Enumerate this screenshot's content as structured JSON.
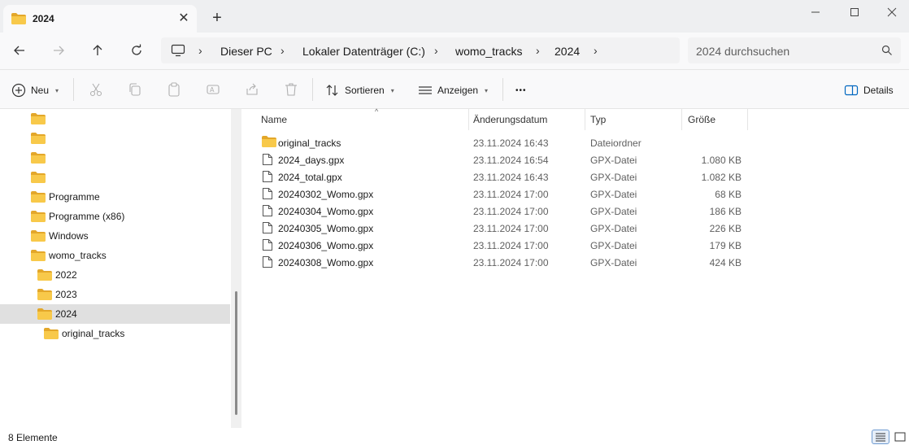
{
  "window": {
    "tab_title": "2024",
    "tab_close": "✕",
    "new_tab": "+"
  },
  "address": {
    "crumbs": [
      "Dieser PC",
      "Lokaler Datenträger (C:)",
      "womo_tracks",
      "2024"
    ],
    "separator": "›",
    "search_placeholder": "2024 durchsuchen"
  },
  "toolbar": {
    "new_label": "Neu",
    "sort_label": "Sortieren",
    "view_label": "Anzeigen",
    "more_label": "•••",
    "details_label": "Details"
  },
  "sidebar": {
    "items": [
      {
        "label": "",
        "indent": 0
      },
      {
        "label": "",
        "indent": 0
      },
      {
        "label": "",
        "indent": 0
      },
      {
        "label": "",
        "indent": 0
      },
      {
        "label": "Programme",
        "indent": 0
      },
      {
        "label": "Programme (x86)",
        "indent": 0
      },
      {
        "label": "Windows",
        "indent": 0
      },
      {
        "label": "womo_tracks",
        "indent": 0
      },
      {
        "label": "2022",
        "indent": 1
      },
      {
        "label": "2023",
        "indent": 1
      },
      {
        "label": "2024",
        "indent": 1,
        "selected": true
      },
      {
        "label": "original_tracks",
        "indent": 2
      }
    ]
  },
  "columns": {
    "name": "Name",
    "date": "Änderungsdatum",
    "type": "Typ",
    "size": "Größe"
  },
  "files": [
    {
      "name": "original_tracks",
      "date": "23.11.2024 16:43",
      "type": "Dateiordner",
      "size": "",
      "kind": "folder"
    },
    {
      "name": "2024_days.gpx",
      "date": "23.11.2024 16:54",
      "type": "GPX-Datei",
      "size": "1.080 KB",
      "kind": "file"
    },
    {
      "name": "2024_total.gpx",
      "date": "23.11.2024 16:43",
      "type": "GPX-Datei",
      "size": "1.082 KB",
      "kind": "file"
    },
    {
      "name": "20240302_Womo.gpx",
      "date": "23.11.2024 17:00",
      "type": "GPX-Datei",
      "size": "68 KB",
      "kind": "file"
    },
    {
      "name": "20240304_Womo.gpx",
      "date": "23.11.2024 17:00",
      "type": "GPX-Datei",
      "size": "186 KB",
      "kind": "file"
    },
    {
      "name": "20240305_Womo.gpx",
      "date": "23.11.2024 17:00",
      "type": "GPX-Datei",
      "size": "226 KB",
      "kind": "file"
    },
    {
      "name": "20240306_Womo.gpx",
      "date": "23.11.2024 17:00",
      "type": "GPX-Datei",
      "size": "179 KB",
      "kind": "file"
    },
    {
      "name": "20240308_Womo.gpx",
      "date": "23.11.2024 17:00",
      "type": "GPX-Datei",
      "size": "424 KB",
      "kind": "file"
    }
  ],
  "status": {
    "count_text": "8 Elemente"
  },
  "colors": {
    "folder_yellow": "#f8c94a",
    "folder_dark": "#e3a72a",
    "selection": "#e0e0e0",
    "accent": "#0067c0"
  }
}
